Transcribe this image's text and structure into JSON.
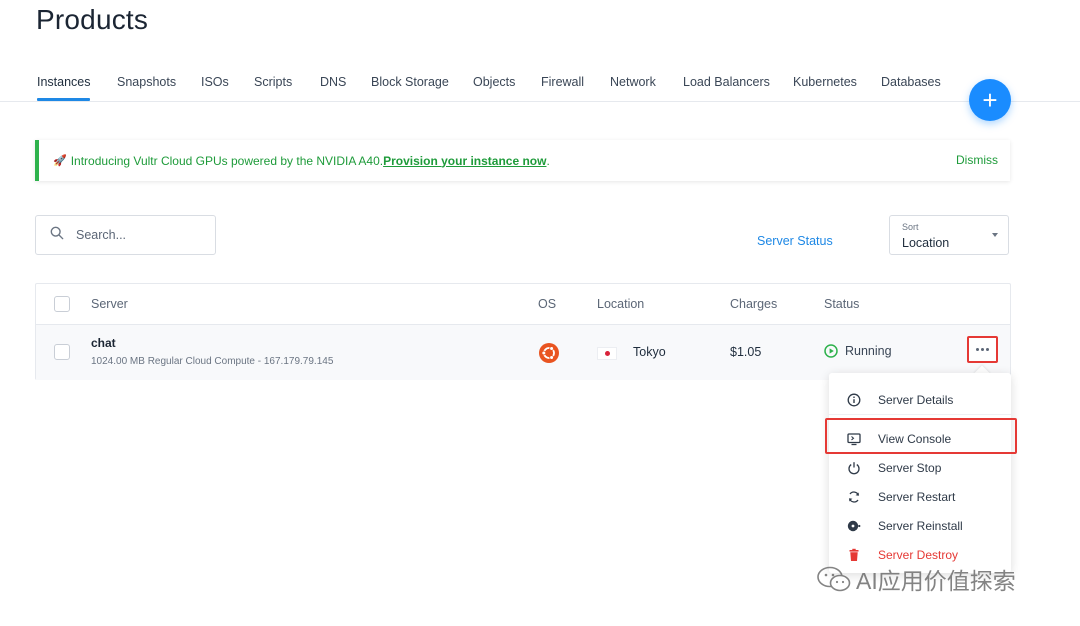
{
  "page": {
    "title": "Products"
  },
  "tabs": [
    {
      "label": "Instances",
      "active": true
    },
    {
      "label": "Snapshots"
    },
    {
      "label": "ISOs"
    },
    {
      "label": "Scripts"
    },
    {
      "label": "DNS"
    },
    {
      "label": "Block Storage"
    },
    {
      "label": "Objects"
    },
    {
      "label": "Firewall"
    },
    {
      "label": "Network"
    },
    {
      "label": "Load Balancers"
    },
    {
      "label": "Kubernetes"
    },
    {
      "label": "Databases"
    }
  ],
  "fab": {
    "label": "+"
  },
  "banner": {
    "icon": "🚀",
    "text": "Introducing Vultr Cloud GPUs powered by the NVIDIA A40. ",
    "link": "Provision your instance now",
    "suffix": ".",
    "dismiss": "Dismiss",
    "accent": "#2eb24c"
  },
  "toolbar": {
    "search_placeholder": "Search...",
    "server_status": "Server Status",
    "sort_label": "Sort",
    "sort_value": "Location"
  },
  "table": {
    "columns": [
      "Server",
      "OS",
      "Location",
      "Charges",
      "Status"
    ],
    "rows": [
      {
        "name": "chat",
        "details": "1024.00 MB Regular Cloud Compute - 167.179.79.145",
        "os_icon": "ubuntu-icon",
        "location": "Tokyo",
        "location_flag": "japan-flag-icon",
        "charges": "$1.05",
        "status": "Running",
        "status_color": "#2eb24c"
      }
    ]
  },
  "menu": {
    "items": [
      {
        "label": "Server Details",
        "icon": "info-icon"
      },
      {
        "label": "View Console",
        "icon": "console-icon",
        "highlighted": true
      },
      {
        "label": "Server Stop",
        "icon": "power-icon"
      },
      {
        "label": "Server Restart",
        "icon": "restart-icon"
      },
      {
        "label": "Server Reinstall",
        "icon": "disc-icon"
      },
      {
        "label": "Server Destroy",
        "icon": "trash-icon",
        "danger": true
      }
    ]
  },
  "watermark": {
    "text": "AI应用价值探索"
  },
  "colors": {
    "primary": "#1e88e5",
    "success": "#2eb24c",
    "danger": "#e53935"
  }
}
